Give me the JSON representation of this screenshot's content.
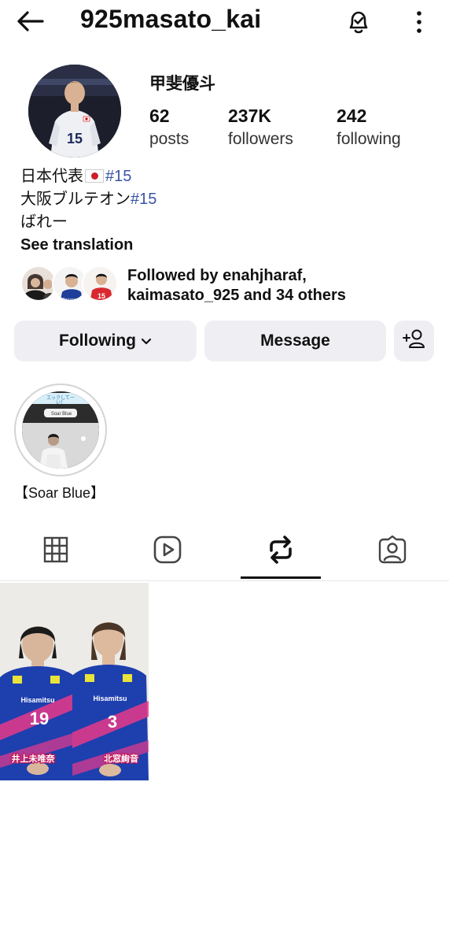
{
  "header": {
    "username": "925masato_kai",
    "back_icon": "arrow-left-icon",
    "bell_icon": "bell-check-icon",
    "more_icon": "more-vertical-icon"
  },
  "profile": {
    "full_name": "甲斐優斗",
    "stats": [
      {
        "value": "62",
        "label": "posts"
      },
      {
        "value": "237K",
        "label": "followers"
      },
      {
        "value": "242",
        "label": "following"
      }
    ],
    "bio": {
      "line1_text": "日本代表",
      "line1_tag": "#15",
      "line2_text": "大阪ブルテオン",
      "line2_tag": "#15",
      "line3": "ばれー"
    },
    "see_translation": "See translation",
    "followed_by_line1": "Followed by enahjharaf,",
    "followed_by_line2": "kaimasato_925 and 34 others"
  },
  "actions": {
    "following": "Following",
    "message": "Message",
    "add_person_icon": "person-add-icon"
  },
  "highlights": [
    {
      "label": "【Soar Blue】",
      "sticker_top": "エックしてー",
      "sticker_sub": "い！",
      "sticker_brand": "Soar Blue"
    }
  ],
  "tabs": [
    {
      "icon": "grid-icon",
      "active": false
    },
    {
      "icon": "reels-icon",
      "active": false
    },
    {
      "icon": "repost-icon",
      "active": true
    },
    {
      "icon": "tagged-icon",
      "active": false
    }
  ],
  "posts": [
    {
      "jersey_brand": "Hisamitsu",
      "players": [
        {
          "number": "19",
          "caption": "井上未唯奈"
        },
        {
          "number": "3",
          "caption": "北窓絢音"
        }
      ]
    }
  ],
  "colors": {
    "hashtag": "#3a53a8",
    "button_bg": "#efeff3",
    "jersey_blue": "#1e3fae",
    "jersey_pink": "#e83a8a"
  }
}
